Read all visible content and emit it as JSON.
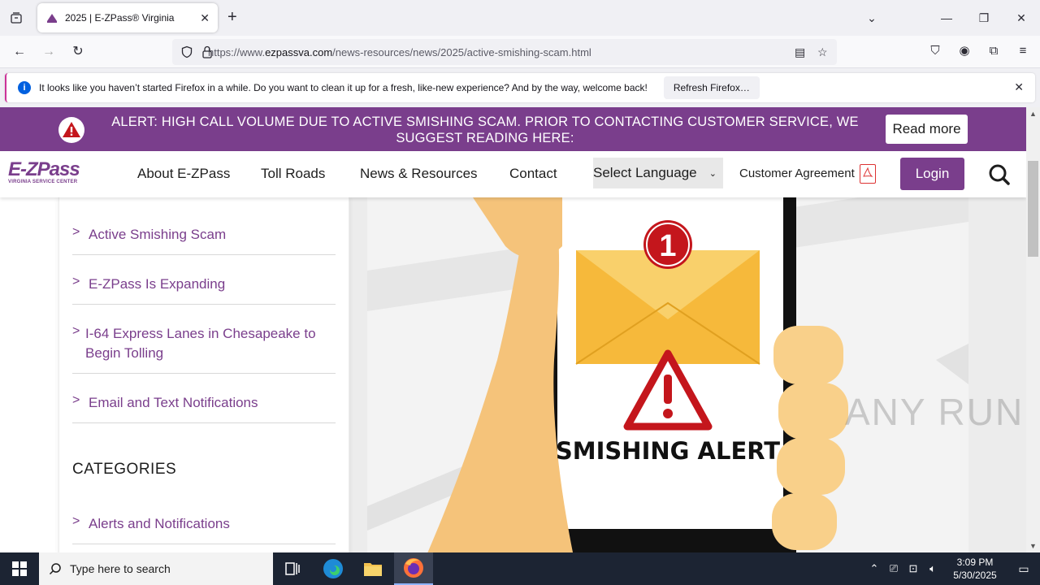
{
  "browser": {
    "tab_title": "2025 | E-ZPass® Virginia",
    "url_prefix": "https://www.",
    "url_domain": "ezpassva.com",
    "url_path": "/news-resources/news/2025/active-smishing-scam.html",
    "notice_text": "It looks like you haven’t started Firefox in a while. Do you want to clean it up for a fresh, like-new experience? And by the way, welcome back!",
    "notice_button": "Refresh Firefox…"
  },
  "site": {
    "alert_text": "ALERT: HIGH CALL VOLUME DUE TO ACTIVE SMISHING SCAM. PRIOR TO CONTACTING CUSTOMER SERVICE, WE SUGGEST READING HERE:",
    "read_more": "Read more",
    "logo_main": "E-ZPass",
    "logo_sub": "VIRGINIA SERVICE CENTER",
    "nav": [
      "About E-ZPass",
      "Toll Roads",
      "News & Resources",
      "Contact"
    ],
    "language_select": "Select Language",
    "customer_agreement": "Customer Agreement",
    "login": "Login",
    "brand_color": "#7a3e8c"
  },
  "sidebar": {
    "items": [
      {
        "arrow": ">",
        "label": "Active Smishing Scam"
      },
      {
        "arrow": ">",
        "label": "E-ZPass Is Expanding"
      },
      {
        "arrow": ">",
        "label": "I-64 Express Lanes in Chesapeake to Begin Tolling"
      },
      {
        "arrow": ">",
        "label": "Email and Text Notifications"
      }
    ],
    "categories_heading": "CATEGORIES",
    "category_items": [
      {
        "arrow": ">",
        "label": "Alerts and Notifications"
      }
    ]
  },
  "article_image": {
    "badge_number": "1",
    "caption": "SMISHING ALERT"
  },
  "watermark": "ANY RUN",
  "taskbar": {
    "search_placeholder": "Type here to search",
    "time": "3:09 PM",
    "date": "5/30/2025"
  }
}
